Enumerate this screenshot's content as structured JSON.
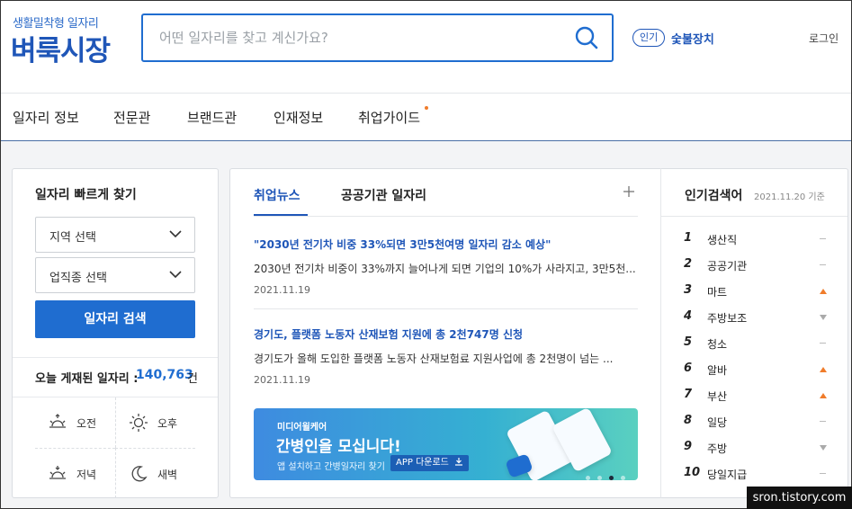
{
  "header": {
    "logo_sub": "생활밀착형 일자리",
    "logo_main": "벼룩시장",
    "search_placeholder": "어떤 일자리를 찾고 계신가요?",
    "popular_badge": "인기",
    "popular_word": "숯불장치",
    "login": "로그인"
  },
  "nav": {
    "items": [
      {
        "label": "일자리 정보"
      },
      {
        "label": "전문관"
      },
      {
        "label": "브랜드관"
      },
      {
        "label": "인재정보"
      },
      {
        "label": "취업가이드"
      }
    ]
  },
  "quick_search": {
    "title": "일자리 빠르게 찾기",
    "region_select": "지역 선택",
    "category_select": "업직종 선택",
    "search_button": "일자리 검색",
    "today_label": "오늘 게재된 일자리 :",
    "today_count": "140,763",
    "today_unit": "건",
    "times": [
      {
        "label": "오전",
        "icon": "sunrise-icon"
      },
      {
        "label": "오후",
        "icon": "sun-icon"
      },
      {
        "label": "저녁",
        "icon": "sunset-icon"
      },
      {
        "label": "새벽",
        "icon": "moon-icon"
      }
    ]
  },
  "news": {
    "tabs": [
      {
        "label": "취업뉴스",
        "active": true
      },
      {
        "label": "공공기관 일자리",
        "active": false
      }
    ],
    "items": [
      {
        "title": "\"2030년 전기차 비중 33%되면 3만5천여명 일자리 감소 예상\"",
        "desc": "2030년 전기차 비중이 33%까지 늘어나게 되면 기업의 10%가 사라지고, 3만5천...",
        "date": "2021.11.19"
      },
      {
        "title": "경기도, 플랫폼 노동자 산재보험 지원에 총 2천747명 신청",
        "desc": "경기도가 올해 도입한 플랫폼 노동자 산재보험료 지원사업에 총 2천명이 넘는 ...",
        "date": "2021.11.19"
      }
    ],
    "banner": {
      "brand": "미디어윌케어",
      "title": "간병인을 모십니다!",
      "sub": "앱 설치하고 간병일자리 찾기",
      "app_button": "APP 다운로드",
      "slide_count": 4,
      "active_slide": 3
    }
  },
  "popular": {
    "title": "인기검색어",
    "date": "2021.11.20 기준",
    "items": [
      {
        "rank": "1",
        "word": "생산직",
        "trend": "same"
      },
      {
        "rank": "2",
        "word": "공공기관",
        "trend": "same"
      },
      {
        "rank": "3",
        "word": "마트",
        "trend": "up"
      },
      {
        "rank": "4",
        "word": "주방보조",
        "trend": "down"
      },
      {
        "rank": "5",
        "word": "청소",
        "trend": "same"
      },
      {
        "rank": "6",
        "word": "알바",
        "trend": "up"
      },
      {
        "rank": "7",
        "word": "부산",
        "trend": "up"
      },
      {
        "rank": "8",
        "word": "일당",
        "trend": "same"
      },
      {
        "rank": "9",
        "word": "주방",
        "trend": "down"
      },
      {
        "rank": "10",
        "word": "당일지급",
        "trend": "same"
      }
    ]
  },
  "watermark": "sron.tistory.com",
  "colors": {
    "brand_blue": "#1f56b8",
    "button_blue": "#1f6dd0",
    "accent_orange": "#f07c2b"
  }
}
